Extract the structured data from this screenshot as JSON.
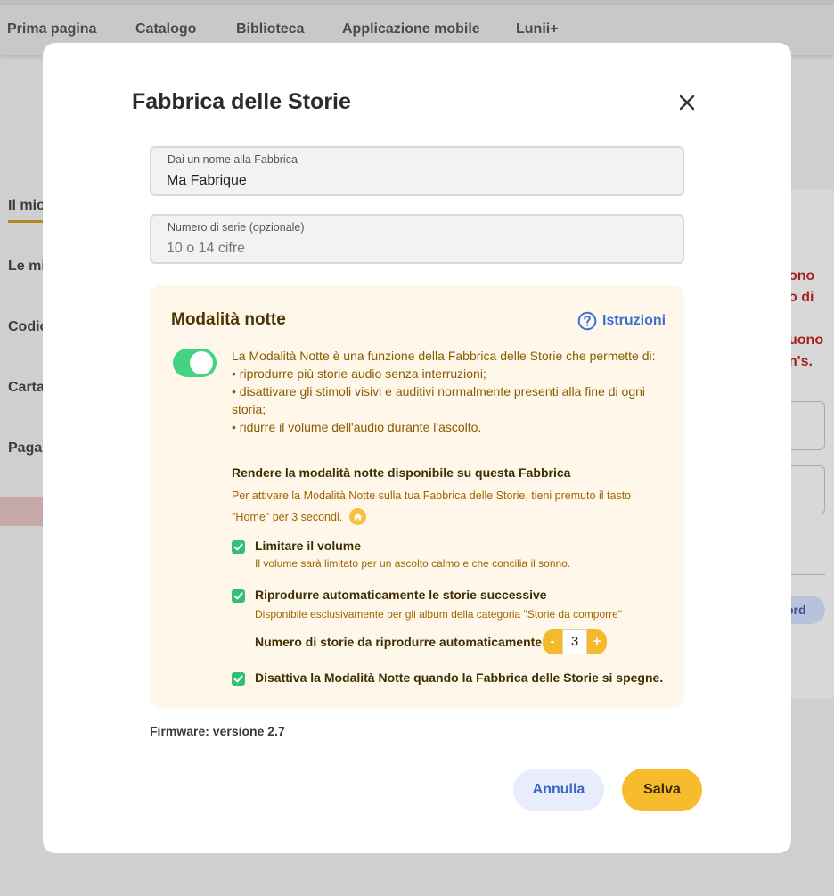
{
  "background": {
    "nav": [
      "Prima pagina",
      "Catalogo",
      "Biblioteca",
      "Applicazione mobile",
      "Lunii+"
    ],
    "sidebar": [
      "Il mio",
      "Le mi",
      "Codic",
      "Carta",
      "Paga"
    ],
    "right_text": [
      "ono",
      "o di",
      "uono",
      "n's."
    ],
    "right_pill": "ord"
  },
  "modal": {
    "title": "Fabbrica delle Storie",
    "name_field": {
      "label": "Dai un nome alla Fabbrica",
      "value": "Ma Fabrique"
    },
    "serial_field": {
      "label": "Numero di serie (opzionale)",
      "placeholder": "10 o 14 cifre"
    },
    "night_mode": {
      "title": "Modalità notte",
      "instructions_label": "Istruzioni",
      "enabled": true,
      "description": [
        "La Modalità Notte è una funzione della Fabbrica delle Storie che permette di:",
        "• riprodurre più storie audio senza interruzioni;",
        "• disattivare gli stimoli visivi e auditivi normalmente presenti alla fine di ogni storia;",
        "• ridurre il volume dell'audio durante l'ascolto."
      ],
      "enable_title": "Rendere la modalità notte disponibile su questa Fabbrica",
      "enable_desc": "Per attivare la Modalità Notte sulla tua Fabbrica delle Storie, tieni premuto il tasto \"Home\" per 3 secondi.",
      "options": {
        "limit_volume": {
          "label": "Limitare il volume",
          "sub": "Il volume sarà limitato per un ascolto calmo e che concilia il sonno.",
          "checked": true
        },
        "autoplay": {
          "label": "Riprodurre automaticamente le storie successive",
          "sub": "Disponibile esclusivamente per gli album della categoria \"Storie da comporre\"",
          "checked": true
        },
        "disable_on_off": {
          "label": "Disattiva la Modalità Notte quando la Fabbrica delle Storie si spegne.",
          "checked": true
        }
      },
      "stepper": {
        "label": "Numero di storie da riprodurre automaticamente",
        "minus": "-",
        "value": "3",
        "plus": "+"
      }
    },
    "firmware": "Firmware: versione 2.7",
    "cancel_label": "Annulla",
    "save_label": "Salva"
  },
  "colors": {
    "accent": "#f7bb2e",
    "toggle_on": "#44d283",
    "checkbox": "#33c074",
    "link": "#3b6fd4"
  }
}
